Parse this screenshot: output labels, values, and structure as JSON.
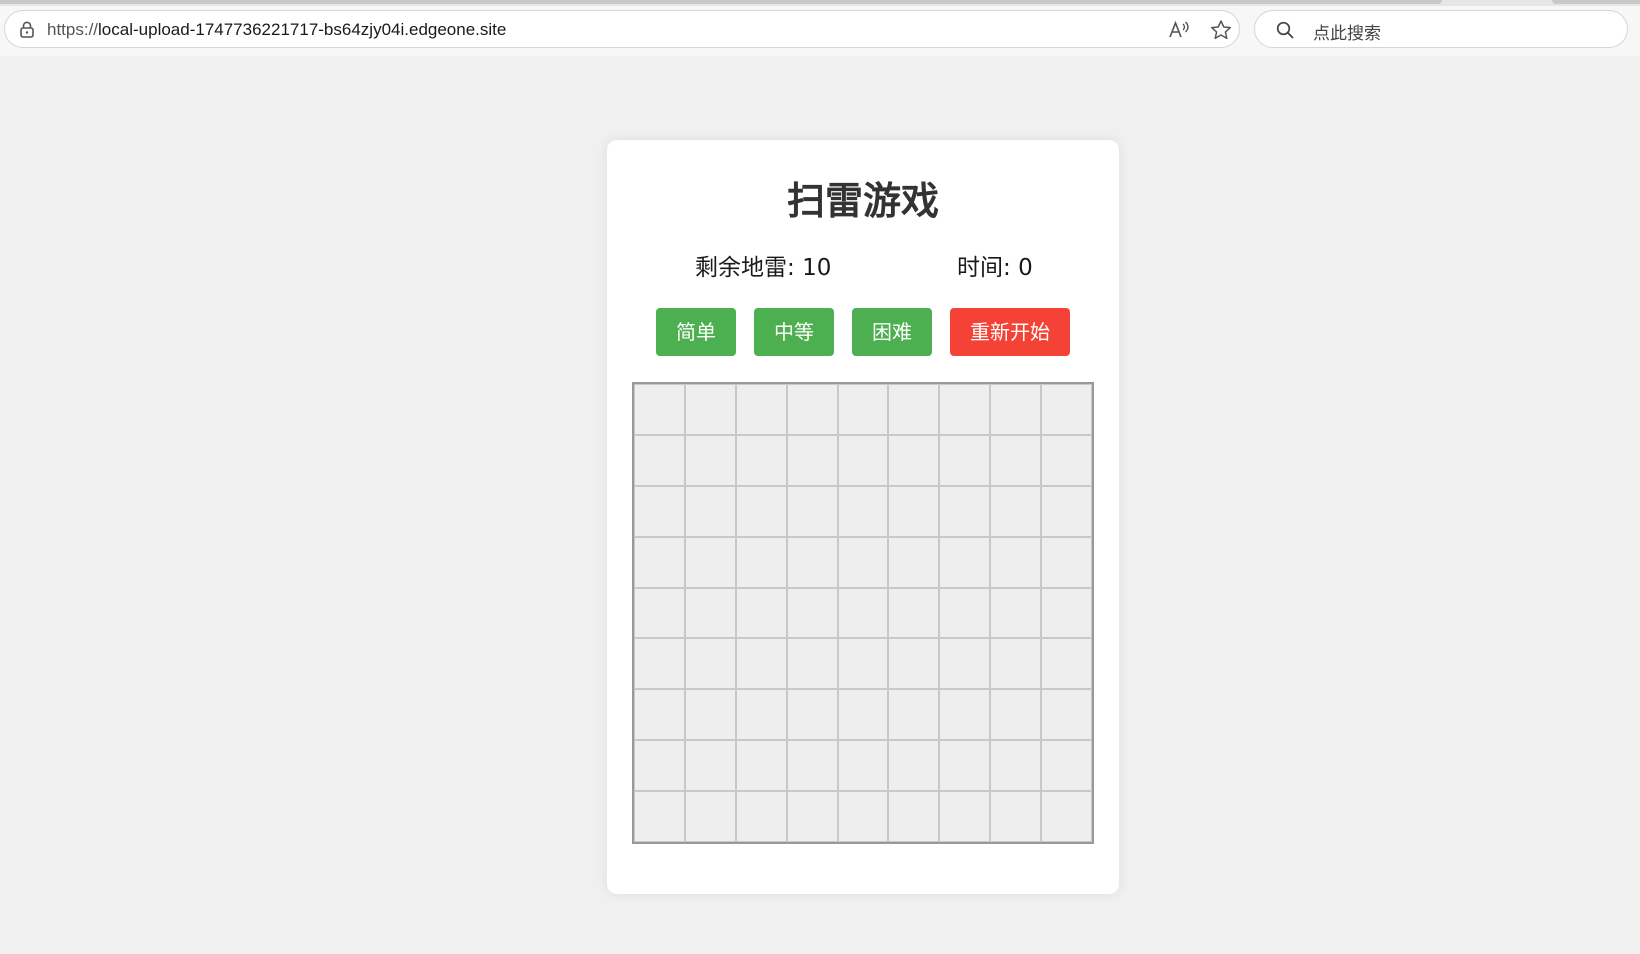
{
  "browser": {
    "url_scheme": "https://",
    "url_rest": "local-upload-1747736221717-bs64zjy04i.edgeone.site",
    "search_placeholder": "点此搜索"
  },
  "game": {
    "title": "扫雷游戏",
    "mines_label": "剩余地雷: ",
    "mines_count": "10",
    "time_label": "时间: ",
    "time_value": "0",
    "buttons": {
      "easy": "简单",
      "medium": "中等",
      "hard": "困难",
      "restart": "重新开始"
    },
    "board": {
      "rows": 9,
      "cols": 9,
      "state": "all-covered"
    }
  },
  "colors": {
    "difficulty_button": "#4caf50",
    "restart_button": "#f44336",
    "cell_covered": "#eeeeee",
    "page_background": "#f0f0f0"
  }
}
